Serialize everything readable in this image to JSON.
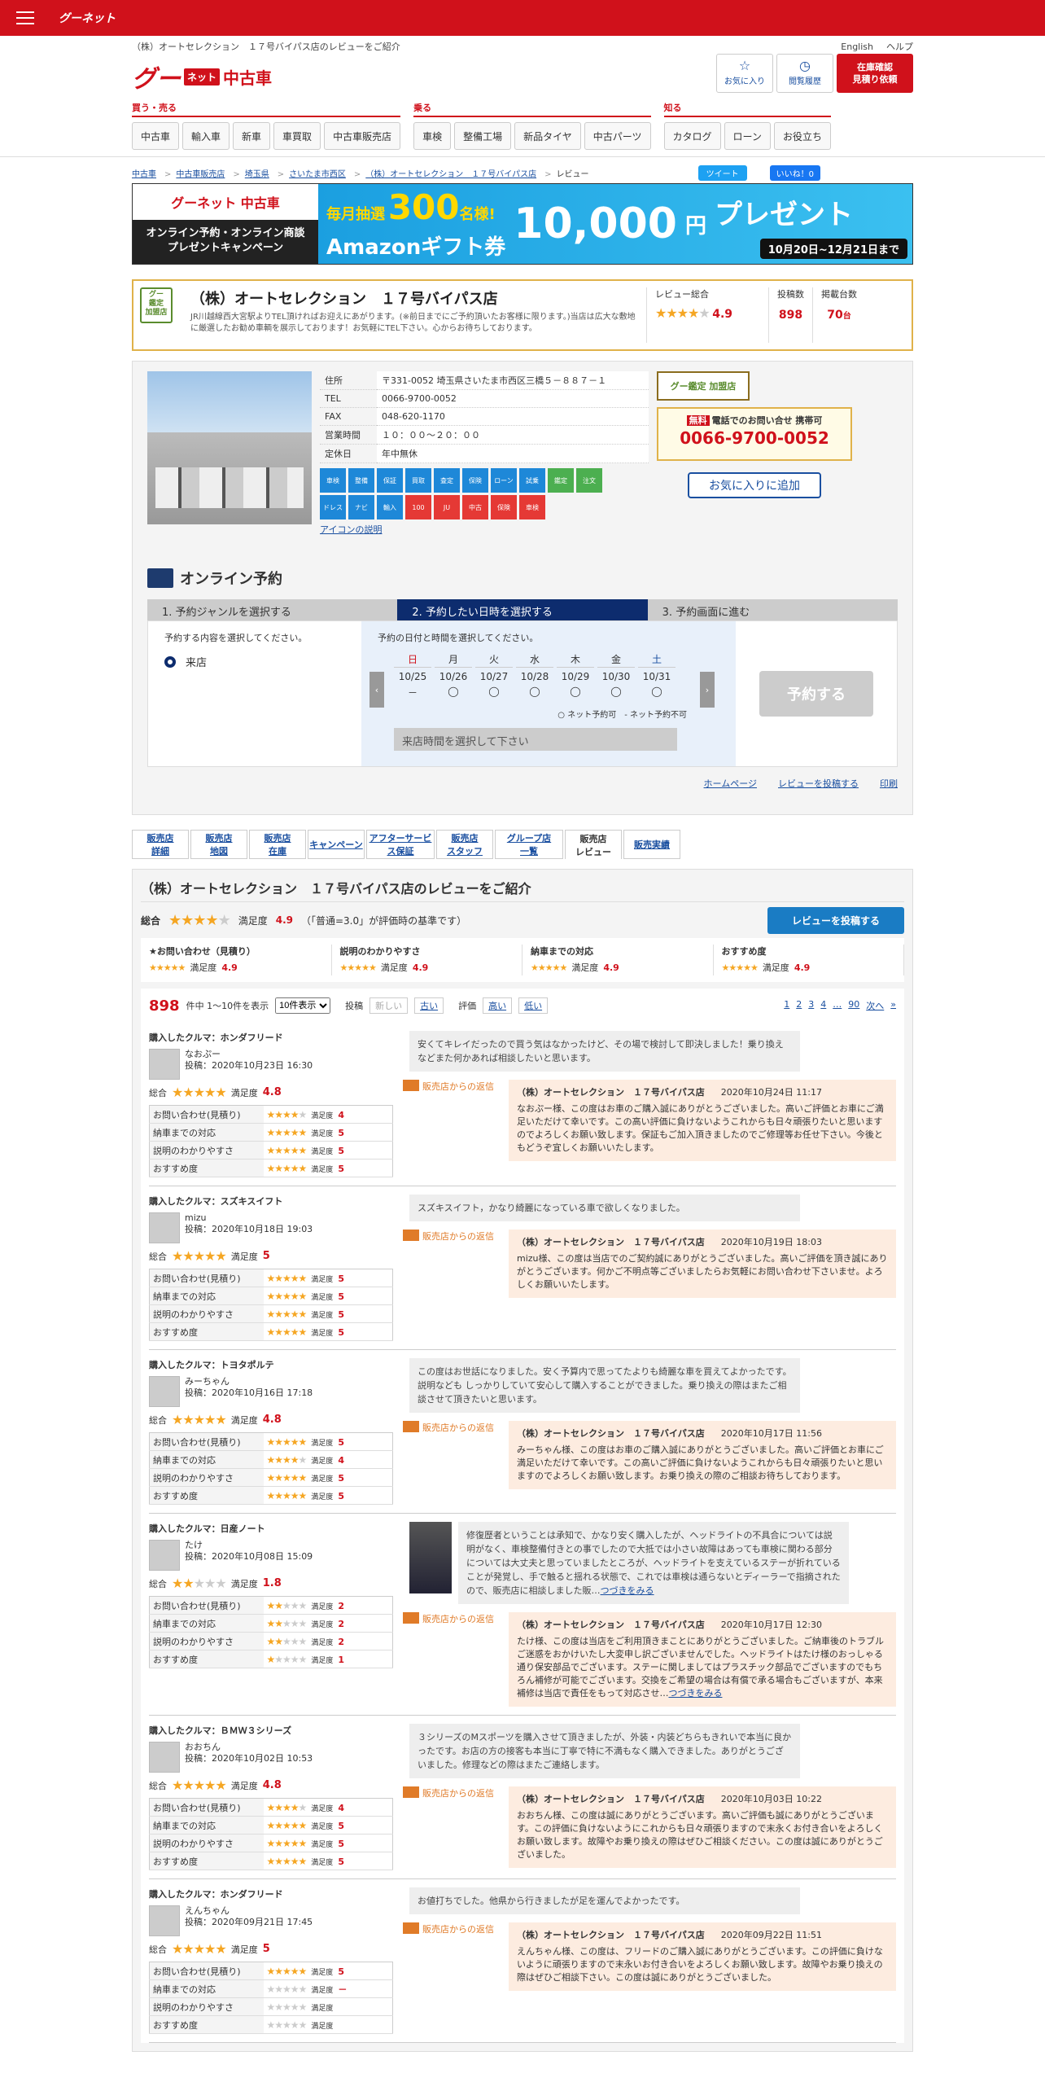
{
  "topbar": {
    "logo": "グーネット"
  },
  "header": {
    "subtitle": "（株）オートセレクション　１７号バイパス店のレビューをご紹介",
    "english": "English",
    "help": "ヘルプ",
    "logo_g": "グー",
    "logo_net": "ネット",
    "logo_cs": "中古車",
    "fav": "お気に入り",
    "history": "閲覧履歴",
    "stock": "在庫確認\n見積り依頼"
  },
  "nav": [
    {
      "title": "買う・売る",
      "items": [
        "中古車",
        "輸入車",
        "新車",
        "車買取",
        "中古車販売店"
      ]
    },
    {
      "title": "乗る",
      "items": [
        "車検",
        "整備工場",
        "新品タイヤ",
        "中古パーツ"
      ]
    },
    {
      "title": "知る",
      "items": [
        "カタログ",
        "ローン",
        "お役立ち"
      ]
    }
  ],
  "breadcrumb": [
    "中古車",
    "中古車販売店",
    "埼玉県",
    "さいたま市西区",
    "（株）オートセレクション　１７号バイパス店",
    "レビュー"
  ],
  "social": {
    "tweet": "ツイート",
    "like": "いいね！0"
  },
  "banner": {
    "logo": "グーネット 中古車",
    "left": "オンライン予約・オンライン商談\nプレゼントキャンペーン",
    "t1": "毎月抽選",
    "t2": "300",
    "t3": "名様!",
    "t4": "Amazonギフト券",
    "t5": "10,000",
    "t6": "円",
    "t7": "プレゼント",
    "date": "10月20日~12月21日まで"
  },
  "shop": {
    "badge": "グー\n鑑定\n加盟店",
    "name": "（株）オートセレクション　１７号バイパス店",
    "desc": "JR川越線西大宮駅よりTEL頂ければお迎えにあがります。(※前日までにご予約頂いたお客様に限ります。)当店は広大な敷地に厳選したお勧め車輌を展示しております！お気軽にTEL下さい。心からお待ちしております。",
    "review_label": "レビュー総合",
    "review_score": "4.9",
    "posts_label": "投稿数",
    "posts": "898",
    "stock_label": "掲載台数",
    "stock": "70",
    "stock_unit": "台"
  },
  "info": [
    [
      "住所",
      "〒331-0052 埼玉県さいたま市西区三橋５－８８７－１"
    ],
    [
      "TEL",
      "0066-9700-0052"
    ],
    [
      "FAX",
      "048-620-1170"
    ],
    [
      "営業時間",
      "１０：００～２０：００"
    ],
    [
      "定休日",
      "年中無休"
    ]
  ],
  "icons": [
    "車検",
    "整備",
    "保証",
    "買取",
    "査定",
    "保険",
    "ローン",
    "試乗",
    "鑑定",
    "注文",
    "ドレス",
    "ナビ",
    "輸入",
    "100",
    "JU",
    "中古",
    "保険",
    "車検"
  ],
  "icon_link": "アイコンの説明",
  "side": {
    "badge": "グー鑑定 加盟店",
    "free": "無料",
    "tel_label": "電話でのお問い合せ 携帯可",
    "tel": "0066-9700-0052",
    "fav": "お気に入りに追加"
  },
  "yoyaku": {
    "title": "オンライン予約",
    "steps": [
      "1. 予約ジャンルを選択する",
      "2. 予約したい日時を選択する",
      "3. 予約画面に進む"
    ],
    "genre_prompt": "予約する内容を選択してください。",
    "genre": "来店",
    "date_prompt": "予約の日付と時間を選択してください。",
    "days": [
      {
        "d": "日",
        "t": "10/25",
        "s": "－"
      },
      {
        "d": "月",
        "t": "10/26",
        "s": "◯"
      },
      {
        "d": "火",
        "t": "10/27",
        "s": "◯"
      },
      {
        "d": "水",
        "t": "10/28",
        "s": "◯"
      },
      {
        "d": "木",
        "t": "10/29",
        "s": "◯"
      },
      {
        "d": "金",
        "t": "10/30",
        "s": "◯"
      },
      {
        "d": "土",
        "t": "10/31",
        "s": "◯"
      }
    ],
    "legend": "○ ネット予約可　- ネット予約不可",
    "time": "来店時間を選択して下さい",
    "btn": "予約する"
  },
  "tools": [
    "ホームページ",
    "レビューを投稿する",
    "印刷"
  ],
  "tabs": [
    "販売店\n詳細",
    "販売店\n地図",
    "販売店\n在庫",
    "キャンペーン",
    "アフターサービス保証",
    "販売店\nスタッフ",
    "グループ店\n一覧",
    "販売店\nレビュー",
    "販売実績"
  ],
  "reviews_section": {
    "title": "（株）オートセレクション　１７号バイパス店のレビューをご紹介",
    "overall": "総合",
    "sat": "満足度",
    "score": "4.9",
    "note": "（「普通=3.0」が評価時の基準です）",
    "post": "レビューを投稿する",
    "sub": [
      {
        "n": "★お問い合わせ（見積り）",
        "v": "4.9"
      },
      {
        "n": "説明のわかりやすさ",
        "v": "4.9"
      },
      {
        "n": "納車までの対応",
        "v": "4.9"
      },
      {
        "n": "おすすめ度",
        "v": "4.9"
      }
    ],
    "count": "898",
    "range": "件中 1～10件を表示",
    "per": "10件表示",
    "sort": "投稿",
    "new": "新しい",
    "old": "古い",
    "eval": "評価",
    "high": "高い",
    "low": "低い",
    "pages": [
      "1",
      "2",
      "3",
      "4",
      "…",
      "90",
      "次へ",
      "»"
    ]
  },
  "labels": {
    "q": "お問い合わせ(見積り)",
    "d": "納車までの対応",
    "e": "説明のわかりやすさ",
    "r": "おすすめ度",
    "sat": "満足度",
    "total": "総合",
    "reply": "販売店からの返信",
    "shop": "（株）オートセレクション　１７号バイパス店"
  },
  "reviews": [
    {
      "car": "購入したクルマ：ホンダフリード",
      "user": "なおぷー",
      "date": "投稿：2020年10月23日 16:30",
      "total": "4.8",
      "r": [
        "4",
        "5",
        "5",
        "5"
      ],
      "comment": "安くてキレイだったので買う気はなかったけど、その場で検討して即決しました！乗り換えなどまた何かあれば相談したいと思います。",
      "rdate": "2020年10月24日 11:17",
      "reply": "なおぷー様、この度はお車のご購入誠にありがとうございました。高いご評価とお車にご満足いただけて幸いです。この高い評価に負けないようこれからも日々頑張りたいと思いますのでよろしくお願い致します。保証もご加入頂きましたのでご修理等お任せ下さい。今後ともどうぞ宜しくお願いいたします。"
    },
    {
      "car": "購入したクルマ：スズキスイフト",
      "user": "mizu",
      "date": "投稿：2020年10月18日 19:03",
      "total": "5",
      "r": [
        "5",
        "5",
        "5",
        "5"
      ],
      "comment": "スズキスイフト，かなり綺麗になっている車で欲しくなりました。",
      "rdate": "2020年10月19日 18:03",
      "reply": "mizu様、この度は当店でのご契約誠にありがとうございました。高いご評価を頂き誠にありがとうございます。何かご不明点等ございましたらお気軽にお問い合わせ下さいませ。よろしくお願いいたします。"
    },
    {
      "car": "購入したクルマ：トヨタポルテ",
      "user": "みーちゃん",
      "date": "投稿：2020年10月16日 17:18",
      "total": "4.8",
      "r": [
        "5",
        "4",
        "5",
        "5"
      ],
      "comment": "この度はお世話になりました。安く予算内で思ってたよりも綺麗な車を買えてよかったです。説明なども しっかりしていて安心して購入することができました。乗り換えの際はまたご相談させて頂きたいと思います。",
      "rdate": "2020年10月17日 11:56",
      "reply": "みーちゃん様、この度はお車のご購入誠にありがとうございました。高いご評価とお車にご満足いただけて幸いです。この高いご評価に負けないようこれからも日々頑張りたいと思いますのでよろしくお願い致します。お乗り換えの際のご相談お待ちしております。"
    },
    {
      "car": "購入したクルマ：日産ノート",
      "user": "たけ",
      "date": "投稿：2020年10月08日 15:09",
      "total": "1.8",
      "r": [
        "2",
        "2",
        "2",
        "1"
      ],
      "comment": "修復歴者ということは承知で、かなり安く購入したが、ヘッドライトの不具合については説明がなく、車検整備付きとの事でしたので大抵では小さい故障はあっても車検に関わる部分については大丈夫と思っていましたところが、ヘッドライトを支えているステーが折れていることが発覚し、手で触ると揺れる状態で、これでは車検は通らないとディーラーで指摘されたので、販売店に相談しました販…",
      "more": "つづきをみる",
      "rdate": "2020年10月17日 12:30",
      "reply": "たけ様、この度は当店をご利用頂きまことにありがとうございました。ご納車後のトラブルご迷惑をおかけいたし大変申し訳ございませんでした。ヘッドライトはたけ様のおっしゃる通り保安部品でございます。ステーに関しましてはプラスチック部品でございますのでもちろん補修が可能でございます。交換をご希望の場合は有償で承る場合もございますが、本来補修は当店で責任をもって対応させ…",
      "more2": "つづきをみる"
    },
    {
      "car": "購入したクルマ：ＢＭＷ３シリーズ",
      "user": "おおちん",
      "date": "投稿：2020年10月02日 10:53",
      "total": "4.8",
      "r": [
        "4",
        "5",
        "5",
        "5"
      ],
      "comment": "３シリーズのMスポーツを購入させて頂きましたが、外装・内装どちらもきれいで本当に良かったです。お店の方の接客も本当に丁寧で特に不満もなく購入できました。ありがとうございました。修理などの際はまたご連絡します。",
      "rdate": "2020年10月03日 10:22",
      "reply": "おおちん様、この度は誠にありがとうございます。高いご評価も誠にありがとうございます。この評価に負けないようにこれからも日々頑張りますので末永くお付き合いをよろしくお願い致します。故障やお乗り換えの際はぜひご相談ください。この度は誠にありがとうございました。"
    },
    {
      "car": "購入したクルマ：ホンダフリード",
      "user": "えんちゃん",
      "date": "投稿：2020年09月21日 17:45",
      "total": "5",
      "r": [
        "5",
        "－",
        "",
        ""
      ],
      "comment": "お値打ちでした。他県から行きましたが足を運んでよかったです。",
      "rdate": "2020年09月22日 11:51",
      "reply": "えんちゃん様、この度は、フリードのご購入誠にありがとうございます。この評価に負けないように頑張りますので末永いお付き合いをよろしくお願い致します。故障やお乗り換えの際はぜひご相談下さい。この度は誠にありがとうございました。"
    }
  ]
}
